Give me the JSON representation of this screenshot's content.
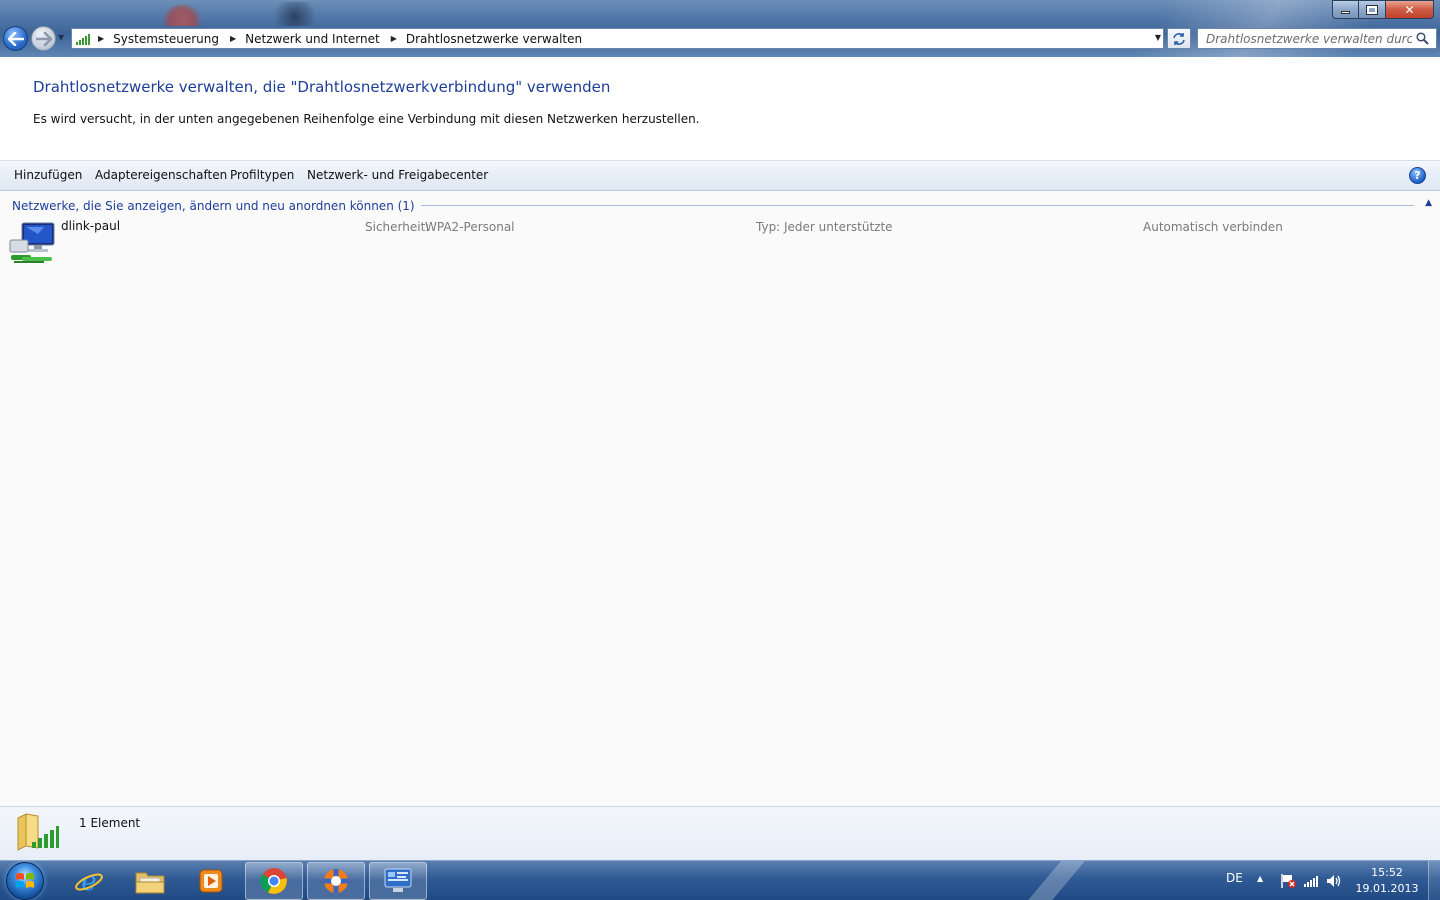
{
  "window": {
    "minimize_label": "",
    "maximize_label": "",
    "close_label": "✕"
  },
  "breadcrumbs": [
    "Systemsteuerung",
    "Netzwerk und Internet",
    "Drahtlosnetzwerke verwalten"
  ],
  "search": {
    "placeholder": "Drahtlosnetzwerke verwalten durchsu..."
  },
  "header": {
    "title": "Drahtlosnetzwerke verwalten, die \"Drahtlosnetzwerkverbindung\" verwenden",
    "subtitle": "Es wird versucht, in der unten angegebenen Reihenfolge eine Verbindung mit diesen Netzwerken herzustellen."
  },
  "toolbar": {
    "add": "Hinzufügen",
    "adapter_properties": "Adaptereigenschaften",
    "profile_types": "Profiltypen",
    "network_center": "Netzwerk- und Freigabecenter",
    "help": "?"
  },
  "group": {
    "header": "Netzwerke, die Sie anzeigen, ändern und neu anordnen können (1)"
  },
  "networks": [
    {
      "name": "dlink-paul",
      "security_label": "Sicherheit:",
      "security_value": "WPA2-Personal",
      "type_label": "Typ:",
      "type_value": "Jeder unterstützte",
      "mode": "Automatisch verbinden"
    }
  ],
  "details": {
    "count": "1 Element"
  },
  "taskbar": {
    "language": "DE",
    "time": "15:52",
    "date": "19.01.2013"
  },
  "colors": {
    "title_blue": "#1e3e9a",
    "taskbar": "#2f5a93"
  }
}
